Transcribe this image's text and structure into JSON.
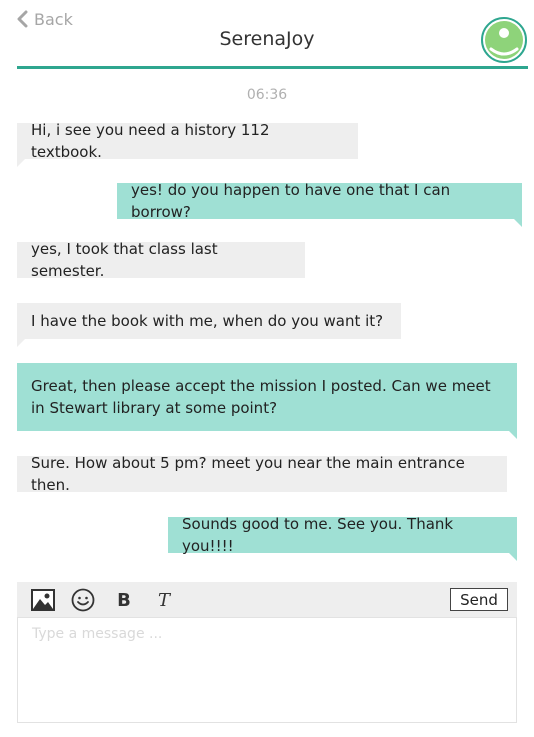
{
  "header": {
    "back_label": "Back",
    "title": "SerenaJoy"
  },
  "chat": {
    "timestamp": "06:36",
    "messages": [
      {
        "direction": "incoming",
        "text": "Hi, i see you need a history 112 textbook."
      },
      {
        "direction": "outgoing",
        "text": "yes! do you happen to have one that I can borrow?"
      },
      {
        "direction": "incoming",
        "text": "yes, I took that class last semester."
      },
      {
        "direction": "incoming",
        "text": "I have the book with me, when do you want it?"
      },
      {
        "direction": "outgoing",
        "text": "Great, then please accept the mission I posted.  Can we meet in Stewart library at some point?"
      },
      {
        "direction": "incoming",
        "text": "Sure. How about 5 pm? meet you near the main entrance then."
      },
      {
        "direction": "outgoing",
        "text": "Sounds good to me. See you. Thank you!!!!"
      }
    ]
  },
  "composer": {
    "tools": [
      "image-icon",
      "emoji-icon",
      "bold-icon",
      "text-style-icon"
    ],
    "bold_label": "B",
    "italic_label": "T",
    "send_label": "Send",
    "placeholder": "Type a message ..."
  },
  "colors": {
    "accent": "#2ea68f",
    "outgoing_bubble": "#9fe0d4",
    "incoming_bubble": "#eeeeee",
    "avatar_green": "#8ed37a"
  }
}
